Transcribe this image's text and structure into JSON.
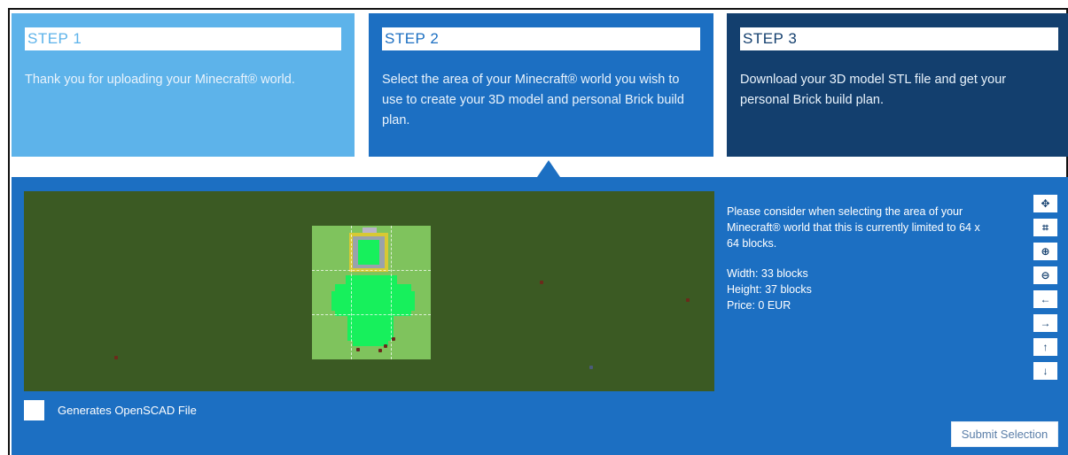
{
  "steps": [
    {
      "title": "STEP 1",
      "text": "Thank you for uploading your Minecraft® world."
    },
    {
      "title": "STEP 2",
      "text": "Select the area of your Minecraft® world you wish to use to create your 3D model and personal Brick build plan."
    },
    {
      "title": "STEP 3",
      "text": "Download your 3D model STL file and get your personal Brick build plan."
    }
  ],
  "info": {
    "note": "Please consider when selecting the area of your Minecraft® world that this is currently limited to 64 x 64 blocks.",
    "width": "Width: 33 blocks",
    "height": "Height: 37 blocks",
    "price": "Price: 0 EUR"
  },
  "tools": [
    {
      "name": "move-icon",
      "glyph": "✥"
    },
    {
      "name": "crop-icon",
      "glyph": "⌗"
    },
    {
      "name": "zoom-in-icon",
      "glyph": "⊕"
    },
    {
      "name": "zoom-out-icon",
      "glyph": "⊖"
    },
    {
      "name": "arrow-left-icon",
      "glyph": "←"
    },
    {
      "name": "arrow-right-icon",
      "glyph": "→"
    },
    {
      "name": "arrow-up-icon",
      "glyph": "↑"
    },
    {
      "name": "arrow-down-icon",
      "glyph": "↓"
    }
  ],
  "options": {
    "openscad_label": "Generates OpenSCAD File"
  },
  "actions": {
    "submit_label": "Submit Selection"
  },
  "colors": {
    "step1": "#5db3ea",
    "step2": "#1c6fc2",
    "step3": "#133f6e",
    "map_ground": "#3b5a23",
    "selection_fill": "#7fc35d",
    "terrain": "#17f05c"
  }
}
